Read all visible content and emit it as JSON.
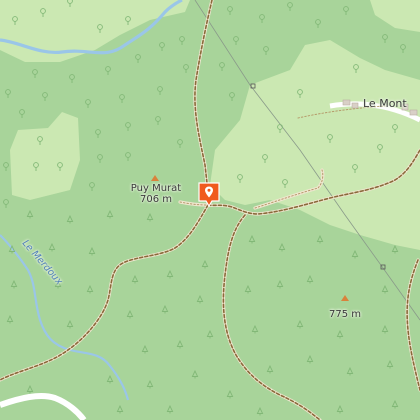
{
  "map": {
    "labels": {
      "puy_murat_name": "Puy Murat",
      "puy_murat_elev": "706 m",
      "peak_775_elev": "775 m",
      "village": "Le Mont",
      "stream": "Le Merdoux"
    },
    "colors": {
      "forest": "#a8d49a",
      "clearing": "#cbe8b2",
      "water": "#9ac6e8",
      "trail": "#8a6a3a",
      "marker": "#f05a1e",
      "peak": "#d9823c"
    },
    "marker": {
      "icon": "location-pin-icon"
    }
  }
}
